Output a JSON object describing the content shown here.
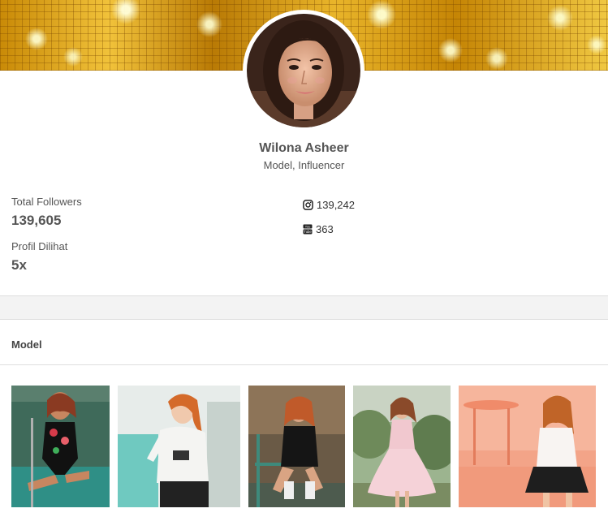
{
  "profile": {
    "name": "Wilona Asheer",
    "role": "Model, Influencer"
  },
  "stats": {
    "followers_label": "Total Followers",
    "followers_value": "139,605",
    "views_label": "Profil Dilihat",
    "views_value": "5x"
  },
  "social": {
    "instagram_icon": "instagram-icon",
    "instagram_count": "139,242",
    "youtube_icon": "youtube-icon",
    "youtube_count": "363"
  },
  "section": {
    "title": "Model"
  },
  "colors": {
    "banner_gold": "#d9a21a",
    "text": "#555555",
    "divider": "#dedede"
  }
}
